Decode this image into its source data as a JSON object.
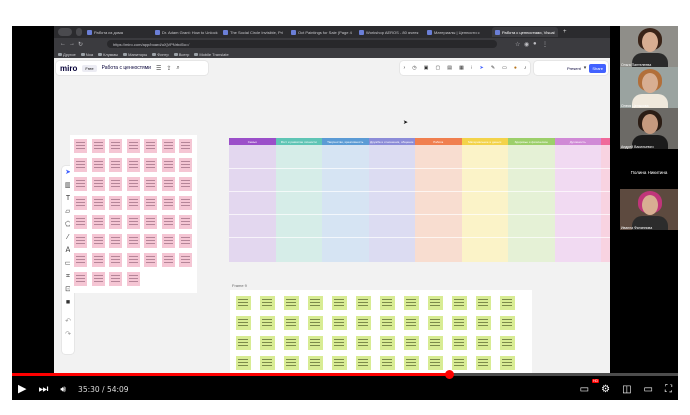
{
  "browser": {
    "tabs": [
      {
        "title": "Работа из дома",
        "active": false
      },
      {
        "title": "Dr. Adam Grant: How to Unlock",
        "active": false
      },
      {
        "title": "The Social Circle Invisible, Pri",
        "active": false
      },
      {
        "title": "Oct Paintings for Sale (Page 4",
        "active": false
      },
      {
        "title": "Workshop AEROS - 80 ячеек",
        "active": false
      },
      {
        "title": "Материалы | Ценности с",
        "active": false
      },
      {
        "title": "Работа с ценностями, Visual",
        "active": true
      }
    ],
    "new_tab": "+",
    "url": "https://miro.com/app/board/uXjVPNrbd5o=/",
    "bookmarks": [
      "Другое",
      "Noa",
      "Клуммы",
      "Маниторы",
      "Финтр",
      "Всегр",
      "Mobile Translate"
    ]
  },
  "miro": {
    "logo": "miro",
    "plan": "Free",
    "board_name": "Работа с ценностями",
    "present_label": "Present",
    "share_label": "Share",
    "frame_label": "Frame 9",
    "columns": [
      {
        "title": "Семья",
        "header": "#9b4fc9",
        "body": "#e3d7ef"
      },
      {
        "title": "Рост и развитие личности",
        "header": "#5fc5b5",
        "body": "#d6ede8"
      },
      {
        "title": "Творчество, креативность",
        "header": "#5b9bd5",
        "body": "#d6e4f3"
      },
      {
        "title": "Дружба и отношения, общение",
        "header": "#8c8cd8",
        "body": "#dcdcf2"
      },
      {
        "title": "Работа",
        "header": "#f07f4f",
        "body": "#f8ddd0"
      },
      {
        "title": "Материальное и деньги",
        "header": "#f3d34a",
        "body": "#fbf3c8"
      },
      {
        "title": "Здоровье и физическое",
        "header": "#9ccf6a",
        "body": "#e5f1d6"
      },
      {
        "title": "Духовность",
        "header": "#d08ad6",
        "body": "#f1daf2"
      },
      {
        "title": "Ресурсы",
        "header": "#f06a9a",
        "body": "#f8d3e1"
      }
    ]
  },
  "participants": [
    {
      "name": "Ольга Пантелеева"
    },
    {
      "name": "Олеся Целыкова"
    },
    {
      "name": "Андрей Васильевич"
    },
    {
      "name": "Полина Никитина",
      "camera": false
    },
    {
      "name": "Иванна Филиппова"
    }
  ],
  "player": {
    "time": "35:30 / 54:09",
    "progress": 0.656,
    "hd": "HD"
  }
}
